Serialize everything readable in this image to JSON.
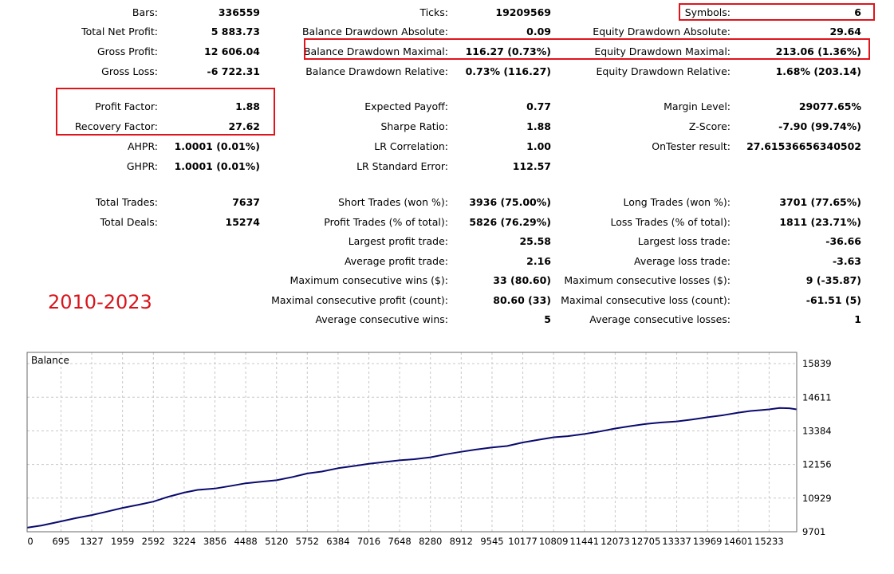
{
  "period_label": "2010-2023",
  "rows": [
    [
      {
        "label": "Bars:",
        "value": "336559"
      },
      {
        "label": "Ticks:",
        "value": "19209569"
      },
      {
        "label": "Symbols:",
        "value": "6"
      }
    ],
    [
      {
        "label": "Total Net Profit:",
        "value": "5 883.73"
      },
      {
        "label": "Balance Drawdown Absolute:",
        "value": "0.09"
      },
      {
        "label": "Equity Drawdown Absolute:",
        "value": "29.64"
      }
    ],
    [
      {
        "label": "Gross Profit:",
        "value": "12 606.04"
      },
      {
        "label": "Balance Drawdown Maximal:",
        "value": "116.27 (0.73%)"
      },
      {
        "label": "Equity Drawdown Maximal:",
        "value": "213.06 (1.36%)"
      }
    ],
    [
      {
        "label": "Gross Loss:",
        "value": "-6 722.31"
      },
      {
        "label": "Balance Drawdown Relative:",
        "value": "0.73% (116.27)"
      },
      {
        "label": "Equity Drawdown Relative:",
        "value": "1.68% (203.14)"
      }
    ],
    [
      {
        "label": "Profit Factor:",
        "value": "1.88"
      },
      {
        "label": "Expected Payoff:",
        "value": "0.77"
      },
      {
        "label": "Margin Level:",
        "value": "29077.65%"
      }
    ],
    [
      {
        "label": "Recovery Factor:",
        "value": "27.62"
      },
      {
        "label": "Sharpe Ratio:",
        "value": "1.88"
      },
      {
        "label": "Z-Score:",
        "value": "-7.90 (99.74%)"
      }
    ],
    [
      {
        "label": "AHPR:",
        "value": "1.0001 (0.01%)"
      },
      {
        "label": "LR Correlation:",
        "value": "1.00"
      },
      {
        "label": "OnTester result:",
        "value": "27.61536656340502"
      }
    ],
    [
      {
        "label": "GHPR:",
        "value": "1.0001 (0.01%)"
      },
      {
        "label": "LR Standard Error:",
        "value": "112.57"
      },
      {
        "label": "",
        "value": ""
      }
    ],
    [
      {
        "label": "Total Trades:",
        "value": "7637"
      },
      {
        "label": "Short Trades (won %):",
        "value": "3936 (75.00%)"
      },
      {
        "label": "Long Trades (won %):",
        "value": "3701 (77.65%)"
      }
    ],
    [
      {
        "label": "Total Deals:",
        "value": "15274"
      },
      {
        "label": "Profit Trades (% of total):",
        "value": "5826 (76.29%)"
      },
      {
        "label": "Loss Trades (% of total):",
        "value": "1811 (23.71%)"
      }
    ],
    [
      {
        "label": "",
        "value": ""
      },
      {
        "label": "Largest profit trade:",
        "value": "25.58"
      },
      {
        "label": "Largest loss trade:",
        "value": "-36.66"
      }
    ],
    [
      {
        "label": "",
        "value": ""
      },
      {
        "label": "Average profit trade:",
        "value": "2.16"
      },
      {
        "label": "Average loss trade:",
        "value": "-3.63"
      }
    ],
    [
      {
        "label": "",
        "value": ""
      },
      {
        "label": "Maximum consecutive wins ($):",
        "value": "33 (80.60)"
      },
      {
        "label": "Maximum consecutive losses ($):",
        "value": "9 (-35.87)"
      }
    ],
    [
      {
        "label": "",
        "value": ""
      },
      {
        "label": "Maximal consecutive profit (count):",
        "value": "80.60 (33)"
      },
      {
        "label": "Maximal consecutive loss (count):",
        "value": "-61.51 (5)"
      }
    ],
    [
      {
        "label": "",
        "value": ""
      },
      {
        "label": "Average consecutive wins:",
        "value": "5"
      },
      {
        "label": "Average consecutive losses:",
        "value": "1"
      }
    ]
  ],
  "colors": {
    "highlight": "#e0141b",
    "period": "#d8141b",
    "line": "#0a0a6e",
    "grid": "#c8c8c8"
  },
  "chart_data": {
    "type": "line",
    "title": "Balance",
    "xlabel": "",
    "ylabel": "",
    "xlim": [
      0,
      15800
    ],
    "ylim": [
      9701,
      16250
    ],
    "x_ticks": [
      0,
      695,
      1327,
      1959,
      2592,
      3224,
      3856,
      4488,
      5120,
      5752,
      6384,
      7016,
      7648,
      8280,
      8912,
      9545,
      10177,
      10809,
      11441,
      12073,
      12705,
      13337,
      13969,
      14601,
      15233
    ],
    "y_ticks": [
      9701,
      10929,
      12156,
      13384,
      14611,
      15839
    ],
    "grid": true,
    "series": [
      {
        "x": [
          0,
          300,
          695,
          1000,
          1327,
          1600,
          1959,
          2300,
          2592,
          2900,
          3224,
          3500,
          3856,
          4200,
          4488,
          4800,
          5120,
          5450,
          5752,
          6050,
          6384,
          6700,
          7016,
          7300,
          7648,
          7950,
          8280,
          8600,
          8912,
          9200,
          9545,
          9850,
          10177,
          10500,
          10809,
          11100,
          11441,
          11750,
          12073,
          12400,
          12705,
          13000,
          13337,
          13650,
          13969,
          14300,
          14601,
          14850,
          15050,
          15233,
          15450,
          15650,
          15800
        ],
        "y": [
          9850,
          9930,
          10080,
          10200,
          10310,
          10420,
          10570,
          10690,
          10800,
          10980,
          11130,
          11230,
          11280,
          11380,
          11470,
          11530,
          11580,
          11700,
          11830,
          11900,
          12020,
          12100,
          12180,
          12240,
          12310,
          12350,
          12420,
          12530,
          12620,
          12700,
          12780,
          12830,
          12960,
          13060,
          13150,
          13190,
          13270,
          13360,
          13470,
          13560,
          13640,
          13690,
          13730,
          13800,
          13880,
          13960,
          14050,
          14110,
          14140,
          14170,
          14220,
          14210,
          14170
        ]
      }
    ]
  }
}
